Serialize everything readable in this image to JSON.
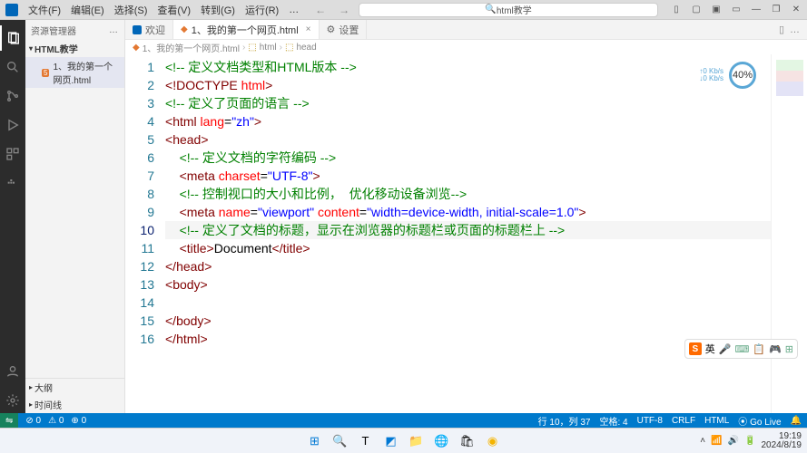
{
  "menu": {
    "file": "文件(F)",
    "edit": "编辑(E)",
    "select": "选择(S)",
    "view": "查看(V)",
    "goto": "转到(G)",
    "run": "运行(R)",
    "more": "…"
  },
  "omnibox": {
    "text": "html教学",
    "search_icon": "🔍"
  },
  "window_controls": {
    "layout1": "▯",
    "layout2": "▢",
    "layout3": "▣",
    "layout4": "▭",
    "min": "―",
    "max": "❐",
    "close": "✕"
  },
  "sidebar": {
    "title": "资源管理器",
    "dots": "…",
    "section": "HTML教学",
    "file": {
      "name": "1、我的第一个网页.html",
      "badge": "5"
    },
    "outline": "大纲",
    "timeline": "时间线"
  },
  "tabs": {
    "t1": "欢迎",
    "t2": "1、我的第一个网页.html",
    "t3": "设置",
    "t2_close": "×",
    "gear": "⚙"
  },
  "tab_actions": {
    "split": "▯",
    "more": "…"
  },
  "breadcrumb": {
    "b1": "1、我的第一个网页.html",
    "b2": "html",
    "b3": "head",
    "sep": "›",
    "icon1": "⬚",
    "icon2": "⬚"
  },
  "perf": {
    "kb": "↑0 Kb/s",
    "kb2": "↓0 Kb/s",
    "pct": "40%"
  },
  "code_lines": [
    {
      "n": "1",
      "tokens": [
        [
          "c-comment",
          "<!-- 定义文档类型和HTML版本 -->"
        ]
      ]
    },
    {
      "n": "2",
      "tokens": [
        [
          "c-bracket",
          "<"
        ],
        [
          "c-doctype",
          "!DOCTYPE "
        ],
        [
          "c-attr",
          "html"
        ],
        [
          "c-bracket",
          ">"
        ]
      ]
    },
    {
      "n": "3",
      "tokens": [
        [
          "c-comment",
          "<!-- 定义了页面的语言 -->"
        ]
      ]
    },
    {
      "n": "4",
      "tokens": [
        [
          "c-bracket",
          "<"
        ],
        [
          "c-tag",
          "html "
        ],
        [
          "c-attr",
          "lang"
        ],
        [
          "c-eq",
          "="
        ],
        [
          "c-string",
          "\"zh\""
        ],
        [
          "c-bracket",
          ">"
        ]
      ]
    },
    {
      "n": "5",
      "tokens": [
        [
          "c-bracket",
          "<"
        ],
        [
          "c-tag",
          "head"
        ],
        [
          "c-bracket",
          ">"
        ]
      ]
    },
    {
      "n": "6",
      "indent": 1,
      "tokens": [
        [
          "c-comment",
          "<!-- 定义文档的字符编码 -->"
        ]
      ]
    },
    {
      "n": "7",
      "indent": 1,
      "tokens": [
        [
          "c-bracket",
          "<"
        ],
        [
          "c-tag",
          "meta "
        ],
        [
          "c-attr",
          "charset"
        ],
        [
          "c-eq",
          "="
        ],
        [
          "c-string",
          "\"UTF-8\""
        ],
        [
          "c-bracket",
          ">"
        ]
      ]
    },
    {
      "n": "8",
      "indent": 1,
      "tokens": [
        [
          "c-comment",
          "<!-- 控制视口的大小和比例，  优化移动设备浏览-->"
        ]
      ]
    },
    {
      "n": "9",
      "indent": 1,
      "tokens": [
        [
          "c-bracket",
          "<"
        ],
        [
          "c-tag",
          "meta "
        ],
        [
          "c-attr",
          "name"
        ],
        [
          "c-eq",
          "="
        ],
        [
          "c-string",
          "\"viewport\" "
        ],
        [
          "c-attr",
          "content"
        ],
        [
          "c-eq",
          "="
        ],
        [
          "c-string",
          "\"width=device-width, initial-scale=1.0\""
        ],
        [
          "c-bracket",
          ">"
        ]
      ]
    },
    {
      "n": "10",
      "indent": 1,
      "active": true,
      "tokens": [
        [
          "c-comment",
          "<!-- 定义了文档的标题，显示在浏览器的标题栏或页面的标题栏上 -->"
        ]
      ]
    },
    {
      "n": "11",
      "indent": 1,
      "tokens": [
        [
          "c-bracket",
          "<"
        ],
        [
          "c-tag",
          "title"
        ],
        [
          "c-bracket",
          ">"
        ],
        [
          "c-text",
          "Document"
        ],
        [
          "c-bracket",
          "</"
        ],
        [
          "c-tag",
          "title"
        ],
        [
          "c-bracket",
          ">"
        ]
      ]
    },
    {
      "n": "12",
      "tokens": [
        [
          "c-bracket",
          "</"
        ],
        [
          "c-tag",
          "head"
        ],
        [
          "c-bracket",
          ">"
        ]
      ]
    },
    {
      "n": "13",
      "tokens": [
        [
          "c-bracket",
          "<"
        ],
        [
          "c-tag",
          "body"
        ],
        [
          "c-bracket",
          ">"
        ]
      ]
    },
    {
      "n": "14",
      "tokens": []
    },
    {
      "n": "15",
      "tokens": [
        [
          "c-bracket",
          "</"
        ],
        [
          "c-tag",
          "body"
        ],
        [
          "c-bracket",
          ">"
        ]
      ]
    },
    {
      "n": "16",
      "tokens": [
        [
          "c-bracket",
          "</"
        ],
        [
          "c-tag",
          "html"
        ],
        [
          "c-bracket",
          ">"
        ]
      ]
    }
  ],
  "status": {
    "remote": "⇋",
    "errors": "⊘ 0",
    "warns": "⚠ 0",
    "port": "⊕ 0",
    "cursor": "行 10，列 37",
    "spaces": "空格: 4",
    "enc": "UTF-8",
    "eol": "CRLF",
    "lang": "HTML",
    "golive": "⦿ Go Live",
    "bell": "🔔"
  },
  "ime": {
    "lang": "英",
    "mic": "🎤",
    "kb": "⌨",
    "clip": "📋",
    "game": "🎮",
    "grid": "⊞"
  },
  "taskbar_icons": {
    "start": "⊞",
    "search": "🔍",
    "task": "T",
    "widgets": "◩",
    "explorer": "📁",
    "edge": "🌐",
    "store": "🛍",
    "chrome": "◉"
  },
  "tray": {
    "up": "˄",
    "net": "📶",
    "vol": "🔊",
    "bat": "🔋",
    "time": "19:19",
    "date": "2024/8/19"
  }
}
